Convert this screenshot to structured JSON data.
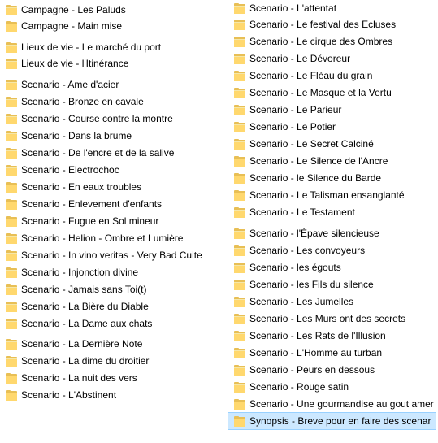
{
  "left_column": [
    "Campagne - Les Paluds",
    "Campagne - Main mise",
    "Lieux de vie - Le marché du port",
    "Lieux de vie - l'Itinérance",
    "Scenario - Ame d'acier",
    "Scenario - Bronze en cavale",
    "Scenario - Course contre la montre",
    "Scenario - Dans la brume",
    "Scenario - De l'encre et de la salive",
    "Scenario - Electrochoc",
    "Scenario - En eaux troubles",
    "Scenario - Enlevement d'enfants",
    "Scenario - Fugue en Sol mineur",
    "Scenario - Helion - Ombre et Lumière",
    "Scenario - In vino veritas - Very Bad Cuite",
    "Scenario - Injonction divine",
    "Scenario - Jamais sans Toi(t)",
    "Scenario - La Bière du Diable",
    "Scenario - La Dame aux chats",
    "Scenario - La Dernière Note",
    "Scenario - La dime du droitier",
    "Scenario - La nuit des vers",
    "Scenario - L'Abstinent"
  ],
  "right_column": [
    "Scenario - L'attentat",
    "Scenario - Le  festival des Ecluses",
    "Scenario - Le cirque des Ombres",
    "Scenario - Le Dévoreur",
    "Scenario - Le Fléau du grain",
    "Scenario - Le Masque et la Vertu",
    "Scenario - Le Parieur",
    "Scenario - Le Potier",
    "Scenario - Le Secret Calciné",
    "Scenario - Le Silence de l'Ancre",
    "Scenario - le Silence du Barde",
    "Scenario - Le Talisman ensanglanté",
    "Scenario - Le Testament",
    "Scenario - l'Épave silencieuse",
    "Scenario - Les convoyeurs",
    "Scenario - les égouts",
    "Scenario - les Fils du silence",
    "Scenario - Les Jumelles",
    "Scenario - Les Murs ont des secrets",
    "Scenario - Les Rats de l'Illusion",
    "Scenario - L'Homme au turban",
    "Scenario - Peurs en dessous",
    "Scenario - Rouge satin",
    "Scenario - Une gourmandise au gout amer",
    "Synopsis - Breve pour en faire des scenar"
  ],
  "selected_item": "Synopsis - Breve pour en faire des scenar",
  "icon": "folder-icon",
  "colors": {
    "selection_bg": "#cce8ff",
    "selection_border": "#99d1ff",
    "folder": "#ffd86e"
  }
}
